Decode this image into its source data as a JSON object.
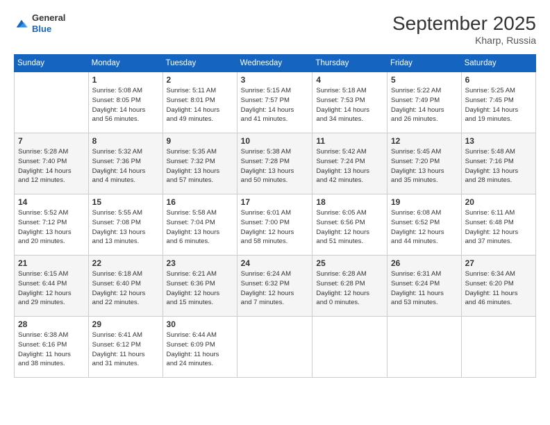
{
  "header": {
    "logo_general": "General",
    "logo_blue": "Blue",
    "title": "September 2025",
    "subtitle": "Kharp, Russia"
  },
  "days_of_week": [
    "Sunday",
    "Monday",
    "Tuesday",
    "Wednesday",
    "Thursday",
    "Friday",
    "Saturday"
  ],
  "weeks": [
    [
      {
        "num": "",
        "info": ""
      },
      {
        "num": "1",
        "info": "Sunrise: 5:08 AM\nSunset: 8:05 PM\nDaylight: 14 hours\nand 56 minutes."
      },
      {
        "num": "2",
        "info": "Sunrise: 5:11 AM\nSunset: 8:01 PM\nDaylight: 14 hours\nand 49 minutes."
      },
      {
        "num": "3",
        "info": "Sunrise: 5:15 AM\nSunset: 7:57 PM\nDaylight: 14 hours\nand 41 minutes."
      },
      {
        "num": "4",
        "info": "Sunrise: 5:18 AM\nSunset: 7:53 PM\nDaylight: 14 hours\nand 34 minutes."
      },
      {
        "num": "5",
        "info": "Sunrise: 5:22 AM\nSunset: 7:49 PM\nDaylight: 14 hours\nand 26 minutes."
      },
      {
        "num": "6",
        "info": "Sunrise: 5:25 AM\nSunset: 7:45 PM\nDaylight: 14 hours\nand 19 minutes."
      }
    ],
    [
      {
        "num": "7",
        "info": "Sunrise: 5:28 AM\nSunset: 7:40 PM\nDaylight: 14 hours\nand 12 minutes."
      },
      {
        "num": "8",
        "info": "Sunrise: 5:32 AM\nSunset: 7:36 PM\nDaylight: 14 hours\nand 4 minutes."
      },
      {
        "num": "9",
        "info": "Sunrise: 5:35 AM\nSunset: 7:32 PM\nDaylight: 13 hours\nand 57 minutes."
      },
      {
        "num": "10",
        "info": "Sunrise: 5:38 AM\nSunset: 7:28 PM\nDaylight: 13 hours\nand 50 minutes."
      },
      {
        "num": "11",
        "info": "Sunrise: 5:42 AM\nSunset: 7:24 PM\nDaylight: 13 hours\nand 42 minutes."
      },
      {
        "num": "12",
        "info": "Sunrise: 5:45 AM\nSunset: 7:20 PM\nDaylight: 13 hours\nand 35 minutes."
      },
      {
        "num": "13",
        "info": "Sunrise: 5:48 AM\nSunset: 7:16 PM\nDaylight: 13 hours\nand 28 minutes."
      }
    ],
    [
      {
        "num": "14",
        "info": "Sunrise: 5:52 AM\nSunset: 7:12 PM\nDaylight: 13 hours\nand 20 minutes."
      },
      {
        "num": "15",
        "info": "Sunrise: 5:55 AM\nSunset: 7:08 PM\nDaylight: 13 hours\nand 13 minutes."
      },
      {
        "num": "16",
        "info": "Sunrise: 5:58 AM\nSunset: 7:04 PM\nDaylight: 13 hours\nand 6 minutes."
      },
      {
        "num": "17",
        "info": "Sunrise: 6:01 AM\nSunset: 7:00 PM\nDaylight: 12 hours\nand 58 minutes."
      },
      {
        "num": "18",
        "info": "Sunrise: 6:05 AM\nSunset: 6:56 PM\nDaylight: 12 hours\nand 51 minutes."
      },
      {
        "num": "19",
        "info": "Sunrise: 6:08 AM\nSunset: 6:52 PM\nDaylight: 12 hours\nand 44 minutes."
      },
      {
        "num": "20",
        "info": "Sunrise: 6:11 AM\nSunset: 6:48 PM\nDaylight: 12 hours\nand 37 minutes."
      }
    ],
    [
      {
        "num": "21",
        "info": "Sunrise: 6:15 AM\nSunset: 6:44 PM\nDaylight: 12 hours\nand 29 minutes."
      },
      {
        "num": "22",
        "info": "Sunrise: 6:18 AM\nSunset: 6:40 PM\nDaylight: 12 hours\nand 22 minutes."
      },
      {
        "num": "23",
        "info": "Sunrise: 6:21 AM\nSunset: 6:36 PM\nDaylight: 12 hours\nand 15 minutes."
      },
      {
        "num": "24",
        "info": "Sunrise: 6:24 AM\nSunset: 6:32 PM\nDaylight: 12 hours\nand 7 minutes."
      },
      {
        "num": "25",
        "info": "Sunrise: 6:28 AM\nSunset: 6:28 PM\nDaylight: 12 hours\nand 0 minutes."
      },
      {
        "num": "26",
        "info": "Sunrise: 6:31 AM\nSunset: 6:24 PM\nDaylight: 11 hours\nand 53 minutes."
      },
      {
        "num": "27",
        "info": "Sunrise: 6:34 AM\nSunset: 6:20 PM\nDaylight: 11 hours\nand 46 minutes."
      }
    ],
    [
      {
        "num": "28",
        "info": "Sunrise: 6:38 AM\nSunset: 6:16 PM\nDaylight: 11 hours\nand 38 minutes."
      },
      {
        "num": "29",
        "info": "Sunrise: 6:41 AM\nSunset: 6:12 PM\nDaylight: 11 hours\nand 31 minutes."
      },
      {
        "num": "30",
        "info": "Sunrise: 6:44 AM\nSunset: 6:09 PM\nDaylight: 11 hours\nand 24 minutes."
      },
      {
        "num": "",
        "info": ""
      },
      {
        "num": "",
        "info": ""
      },
      {
        "num": "",
        "info": ""
      },
      {
        "num": "",
        "info": ""
      }
    ]
  ]
}
